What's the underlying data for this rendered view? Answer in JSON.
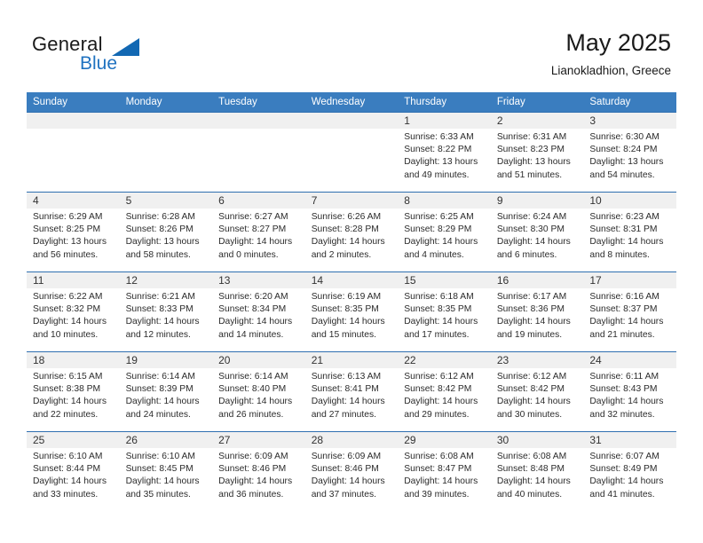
{
  "logo": {
    "word1": "General",
    "word2": "Blue",
    "triangle_color": "#1268b3",
    "blue_text_color": "#1f72c0"
  },
  "header": {
    "month_title": "May 2025",
    "location": "Lianokladhion, Greece"
  },
  "theme": {
    "header_row_bg": "#3a7dbf",
    "row_divider": "#2f6fb0",
    "daynum_bg": "#f0f0f0"
  },
  "calendar": {
    "weekday_headers": [
      "Sunday",
      "Monday",
      "Tuesday",
      "Wednesday",
      "Thursday",
      "Friday",
      "Saturday"
    ],
    "weeks": [
      [
        {
          "day": "",
          "blank": true
        },
        {
          "day": "",
          "blank": true
        },
        {
          "day": "",
          "blank": true
        },
        {
          "day": "",
          "blank": true
        },
        {
          "day": "1",
          "sunrise": "Sunrise: 6:33 AM",
          "sunset": "Sunset: 8:22 PM",
          "daylight": "Daylight: 13 hours and 49 minutes."
        },
        {
          "day": "2",
          "sunrise": "Sunrise: 6:31 AM",
          "sunset": "Sunset: 8:23 PM",
          "daylight": "Daylight: 13 hours and 51 minutes."
        },
        {
          "day": "3",
          "sunrise": "Sunrise: 6:30 AM",
          "sunset": "Sunset: 8:24 PM",
          "daylight": "Daylight: 13 hours and 54 minutes."
        }
      ],
      [
        {
          "day": "4",
          "sunrise": "Sunrise: 6:29 AM",
          "sunset": "Sunset: 8:25 PM",
          "daylight": "Daylight: 13 hours and 56 minutes."
        },
        {
          "day": "5",
          "sunrise": "Sunrise: 6:28 AM",
          "sunset": "Sunset: 8:26 PM",
          "daylight": "Daylight: 13 hours and 58 minutes."
        },
        {
          "day": "6",
          "sunrise": "Sunrise: 6:27 AM",
          "sunset": "Sunset: 8:27 PM",
          "daylight": "Daylight: 14 hours and 0 minutes."
        },
        {
          "day": "7",
          "sunrise": "Sunrise: 6:26 AM",
          "sunset": "Sunset: 8:28 PM",
          "daylight": "Daylight: 14 hours and 2 minutes."
        },
        {
          "day": "8",
          "sunrise": "Sunrise: 6:25 AM",
          "sunset": "Sunset: 8:29 PM",
          "daylight": "Daylight: 14 hours and 4 minutes."
        },
        {
          "day": "9",
          "sunrise": "Sunrise: 6:24 AM",
          "sunset": "Sunset: 8:30 PM",
          "daylight": "Daylight: 14 hours and 6 minutes."
        },
        {
          "day": "10",
          "sunrise": "Sunrise: 6:23 AM",
          "sunset": "Sunset: 8:31 PM",
          "daylight": "Daylight: 14 hours and 8 minutes."
        }
      ],
      [
        {
          "day": "11",
          "sunrise": "Sunrise: 6:22 AM",
          "sunset": "Sunset: 8:32 PM",
          "daylight": "Daylight: 14 hours and 10 minutes."
        },
        {
          "day": "12",
          "sunrise": "Sunrise: 6:21 AM",
          "sunset": "Sunset: 8:33 PM",
          "daylight": "Daylight: 14 hours and 12 minutes."
        },
        {
          "day": "13",
          "sunrise": "Sunrise: 6:20 AM",
          "sunset": "Sunset: 8:34 PM",
          "daylight": "Daylight: 14 hours and 14 minutes."
        },
        {
          "day": "14",
          "sunrise": "Sunrise: 6:19 AM",
          "sunset": "Sunset: 8:35 PM",
          "daylight": "Daylight: 14 hours and 15 minutes."
        },
        {
          "day": "15",
          "sunrise": "Sunrise: 6:18 AM",
          "sunset": "Sunset: 8:35 PM",
          "daylight": "Daylight: 14 hours and 17 minutes."
        },
        {
          "day": "16",
          "sunrise": "Sunrise: 6:17 AM",
          "sunset": "Sunset: 8:36 PM",
          "daylight": "Daylight: 14 hours and 19 minutes."
        },
        {
          "day": "17",
          "sunrise": "Sunrise: 6:16 AM",
          "sunset": "Sunset: 8:37 PM",
          "daylight": "Daylight: 14 hours and 21 minutes."
        }
      ],
      [
        {
          "day": "18",
          "sunrise": "Sunrise: 6:15 AM",
          "sunset": "Sunset: 8:38 PM",
          "daylight": "Daylight: 14 hours and 22 minutes."
        },
        {
          "day": "19",
          "sunrise": "Sunrise: 6:14 AM",
          "sunset": "Sunset: 8:39 PM",
          "daylight": "Daylight: 14 hours and 24 minutes."
        },
        {
          "day": "20",
          "sunrise": "Sunrise: 6:14 AM",
          "sunset": "Sunset: 8:40 PM",
          "daylight": "Daylight: 14 hours and 26 minutes."
        },
        {
          "day": "21",
          "sunrise": "Sunrise: 6:13 AM",
          "sunset": "Sunset: 8:41 PM",
          "daylight": "Daylight: 14 hours and 27 minutes."
        },
        {
          "day": "22",
          "sunrise": "Sunrise: 6:12 AM",
          "sunset": "Sunset: 8:42 PM",
          "daylight": "Daylight: 14 hours and 29 minutes."
        },
        {
          "day": "23",
          "sunrise": "Sunrise: 6:12 AM",
          "sunset": "Sunset: 8:42 PM",
          "daylight": "Daylight: 14 hours and 30 minutes."
        },
        {
          "day": "24",
          "sunrise": "Sunrise: 6:11 AM",
          "sunset": "Sunset: 8:43 PM",
          "daylight": "Daylight: 14 hours and 32 minutes."
        }
      ],
      [
        {
          "day": "25",
          "sunrise": "Sunrise: 6:10 AM",
          "sunset": "Sunset: 8:44 PM",
          "daylight": "Daylight: 14 hours and 33 minutes."
        },
        {
          "day": "26",
          "sunrise": "Sunrise: 6:10 AM",
          "sunset": "Sunset: 8:45 PM",
          "daylight": "Daylight: 14 hours and 35 minutes."
        },
        {
          "day": "27",
          "sunrise": "Sunrise: 6:09 AM",
          "sunset": "Sunset: 8:46 PM",
          "daylight": "Daylight: 14 hours and 36 minutes."
        },
        {
          "day": "28",
          "sunrise": "Sunrise: 6:09 AM",
          "sunset": "Sunset: 8:46 PM",
          "daylight": "Daylight: 14 hours and 37 minutes."
        },
        {
          "day": "29",
          "sunrise": "Sunrise: 6:08 AM",
          "sunset": "Sunset: 8:47 PM",
          "daylight": "Daylight: 14 hours and 39 minutes."
        },
        {
          "day": "30",
          "sunrise": "Sunrise: 6:08 AM",
          "sunset": "Sunset: 8:48 PM",
          "daylight": "Daylight: 14 hours and 40 minutes."
        },
        {
          "day": "31",
          "sunrise": "Sunrise: 6:07 AM",
          "sunset": "Sunset: 8:49 PM",
          "daylight": "Daylight: 14 hours and 41 minutes."
        }
      ]
    ]
  }
}
